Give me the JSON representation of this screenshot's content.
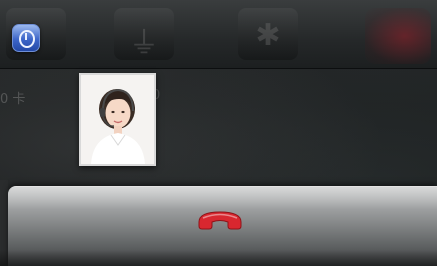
{
  "top_bar": {
    "icons": [
      "clock-icon",
      "usb-icon",
      "bluetooth-icon",
      "phone-icon"
    ]
  },
  "background": {
    "left_text": "0 卡",
    "mid_text": "0"
  },
  "contact": {
    "photo": "contact-avatar-headset"
  },
  "call_controls": {
    "end_call_icon": "end-call-icon",
    "end_call_color": "#d8272f"
  }
}
